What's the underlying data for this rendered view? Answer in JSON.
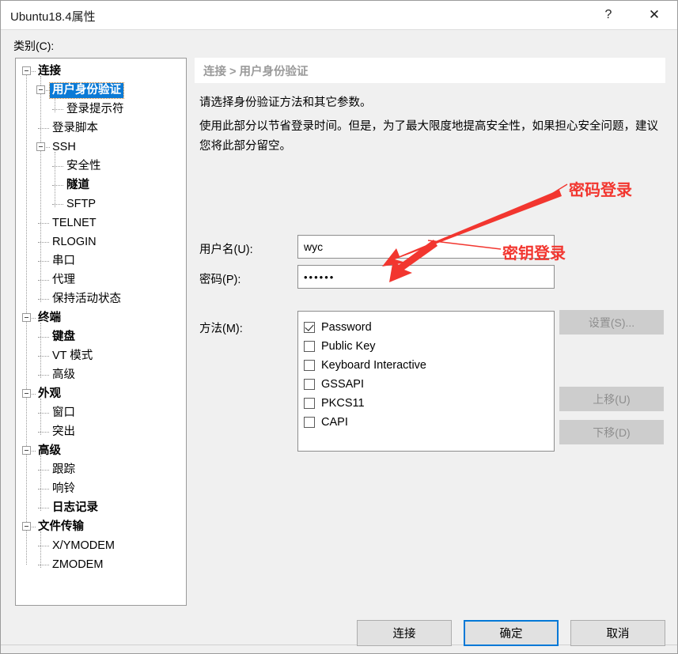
{
  "window": {
    "title": "Ubuntu18.4属性",
    "help_icon": "?",
    "close_icon": "✕"
  },
  "category": {
    "label": "类别(C):",
    "tree": [
      {
        "label": "连接",
        "depth": 0,
        "bold": true,
        "expander": true,
        "selected": false
      },
      {
        "label": "用户身份验证",
        "depth": 1,
        "bold": true,
        "expander": true,
        "selected": true
      },
      {
        "label": "登录提示符",
        "depth": 2,
        "bold": false,
        "expander": false,
        "selected": false
      },
      {
        "label": "登录脚本",
        "depth": 1,
        "bold": false,
        "expander": false,
        "selected": false
      },
      {
        "label": "SSH",
        "depth": 1,
        "bold": false,
        "expander": true,
        "selected": false
      },
      {
        "label": "安全性",
        "depth": 2,
        "bold": false,
        "expander": false,
        "selected": false
      },
      {
        "label": "隧道",
        "depth": 2,
        "bold": true,
        "expander": false,
        "selected": false
      },
      {
        "label": "SFTP",
        "depth": 2,
        "bold": false,
        "expander": false,
        "selected": false
      },
      {
        "label": "TELNET",
        "depth": 1,
        "bold": false,
        "expander": false,
        "selected": false
      },
      {
        "label": "RLOGIN",
        "depth": 1,
        "bold": false,
        "expander": false,
        "selected": false
      },
      {
        "label": "串口",
        "depth": 1,
        "bold": false,
        "expander": false,
        "selected": false
      },
      {
        "label": "代理",
        "depth": 1,
        "bold": false,
        "expander": false,
        "selected": false
      },
      {
        "label": "保持活动状态",
        "depth": 1,
        "bold": false,
        "expander": false,
        "selected": false
      },
      {
        "label": "终端",
        "depth": 0,
        "bold": true,
        "expander": true,
        "selected": false
      },
      {
        "label": "键盘",
        "depth": 1,
        "bold": true,
        "expander": false,
        "selected": false
      },
      {
        "label": "VT 模式",
        "depth": 1,
        "bold": false,
        "expander": false,
        "selected": false
      },
      {
        "label": "高级",
        "depth": 1,
        "bold": false,
        "expander": false,
        "selected": false
      },
      {
        "label": "外观",
        "depth": 0,
        "bold": true,
        "expander": true,
        "selected": false
      },
      {
        "label": "窗口",
        "depth": 1,
        "bold": false,
        "expander": false,
        "selected": false
      },
      {
        "label": "突出",
        "depth": 1,
        "bold": false,
        "expander": false,
        "selected": false
      },
      {
        "label": "高级",
        "depth": 0,
        "bold": true,
        "expander": true,
        "selected": false
      },
      {
        "label": "跟踪",
        "depth": 1,
        "bold": false,
        "expander": false,
        "selected": false
      },
      {
        "label": "响铃",
        "depth": 1,
        "bold": false,
        "expander": false,
        "selected": false
      },
      {
        "label": "日志记录",
        "depth": 1,
        "bold": true,
        "expander": false,
        "selected": false
      },
      {
        "label": "文件传输",
        "depth": 0,
        "bold": true,
        "expander": true,
        "selected": false
      },
      {
        "label": "X/YMODEM",
        "depth": 1,
        "bold": false,
        "expander": false,
        "selected": false
      },
      {
        "label": "ZMODEM",
        "depth": 1,
        "bold": false,
        "expander": false,
        "selected": false
      }
    ]
  },
  "content": {
    "breadcrumb": "连接 > 用户身份验证",
    "description_line1": "请选择身份验证方法和其它参数。",
    "description_line2": "使用此部分以节省登录时间。但是，为了最大限度地提高安全性，如果担心安全问题，建议您将此部分留空。",
    "username": {
      "label": "用户名(U):",
      "value": "wyc",
      "placeholder": ""
    },
    "password": {
      "label": "密码(P):",
      "value": "••••••",
      "masked_length": 6,
      "placeholder": ""
    },
    "method": {
      "label": "方法(M):",
      "items": [
        {
          "label": "Password",
          "checked": true
        },
        {
          "label": "Public Key",
          "checked": false
        },
        {
          "label": "Keyboard Interactive",
          "checked": false
        },
        {
          "label": "GSSAPI",
          "checked": false
        },
        {
          "label": "PKCS11",
          "checked": false
        },
        {
          "label": "CAPI",
          "checked": false
        }
      ]
    },
    "side_buttons": [
      {
        "label": "设置(S)...",
        "enabled": false
      },
      {
        "label": "上移(U)",
        "enabled": false
      },
      {
        "label": "下移(D)",
        "enabled": false
      }
    ]
  },
  "annotations": {
    "color": "#f2362f",
    "password_login": "密码登录",
    "key_login": "密钥登录"
  },
  "footer": {
    "connect": "连接",
    "ok": "确定",
    "cancel": "取消"
  }
}
